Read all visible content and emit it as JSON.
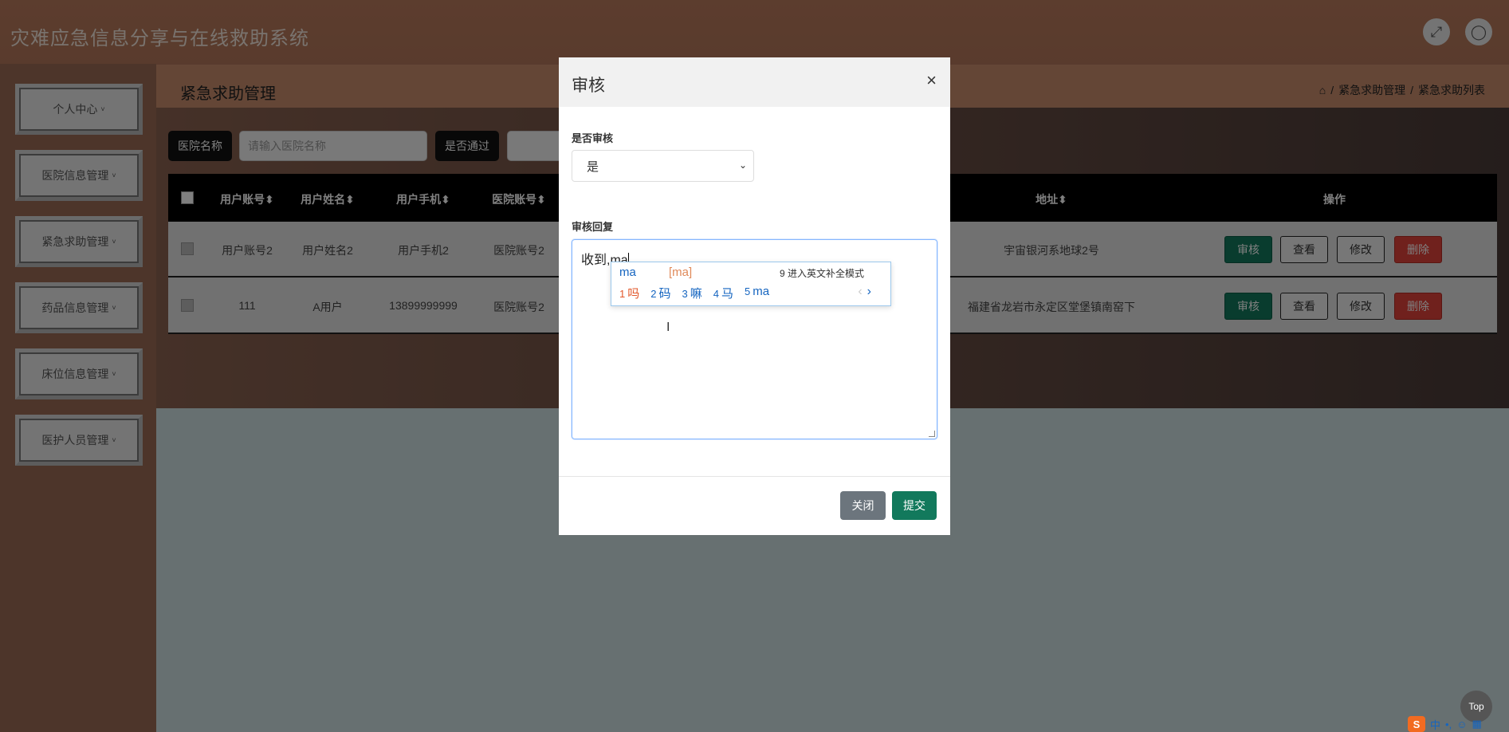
{
  "app": {
    "title": "灾难应急信息分享与在线救助系统"
  },
  "topbar": {
    "fullscreen_icon": "fullscreen-icon",
    "user_icon": "user-icon"
  },
  "sidebar": {
    "items": [
      {
        "label": "个人中心"
      },
      {
        "label": "医院信息管理"
      },
      {
        "label": "紧急求助管理"
      },
      {
        "label": "药品信息管理"
      },
      {
        "label": "床位信息管理"
      },
      {
        "label": "医护人员管理"
      }
    ],
    "caret": "˅"
  },
  "header": {
    "title": "紧急求助管理",
    "breadcrumb": {
      "home_icon": "home-icon",
      "sep": "/",
      "level1": "紧急求助管理",
      "level2": "紧急求助列表"
    }
  },
  "search": {
    "hospital_label": "医院名称",
    "hospital_placeholder": "请输入医院名称",
    "passed_label": "是否通过"
  },
  "table": {
    "columns": [
      "用户账号",
      "用户姓名",
      "用户手机",
      "医院账号",
      "地址",
      "操作"
    ],
    "sort_icon": "⬍",
    "rows": [
      {
        "account": "用户账号2",
        "name": "用户姓名2",
        "phone": "用户手机2",
        "hospital": "医院账号2",
        "address": "宇宙银河系地球2号"
      },
      {
        "account": "111",
        "name": "A用户",
        "phone": "13899999999",
        "hospital": "医院账号2",
        "address": "福建省龙岩市永定区堂堡镇南窑下"
      }
    ],
    "actions": {
      "audit": "审核",
      "view": "查看",
      "edit": "修改",
      "delete": "删除"
    }
  },
  "modal": {
    "title": "审核",
    "close_symbol": "×",
    "audit_label": "是否审核",
    "audit_value": "是",
    "reply_label": "审核回复",
    "reply_value": "收到,ma",
    "close_button": "关闭",
    "submit_button": "提交"
  },
  "ime": {
    "input": "ma",
    "pinyin": "[ma]",
    "hint": "9 进入英文补全模式",
    "candidates": [
      {
        "num": "1",
        "text": "吗"
      },
      {
        "num": "2",
        "text": "码"
      },
      {
        "num": "3",
        "text": "嘛"
      },
      {
        "num": "4",
        "text": "马"
      },
      {
        "num": "5",
        "text": "ma"
      }
    ],
    "prev": "‹",
    "next": "›"
  },
  "misc": {
    "top_button": "Top",
    "tray_logo": "S",
    "tray_mode": "中"
  },
  "colors": {
    "primary": "#12795c",
    "danger": "#e0433a",
    "secondary": "#6c757d",
    "accent": "#c88d6d"
  }
}
